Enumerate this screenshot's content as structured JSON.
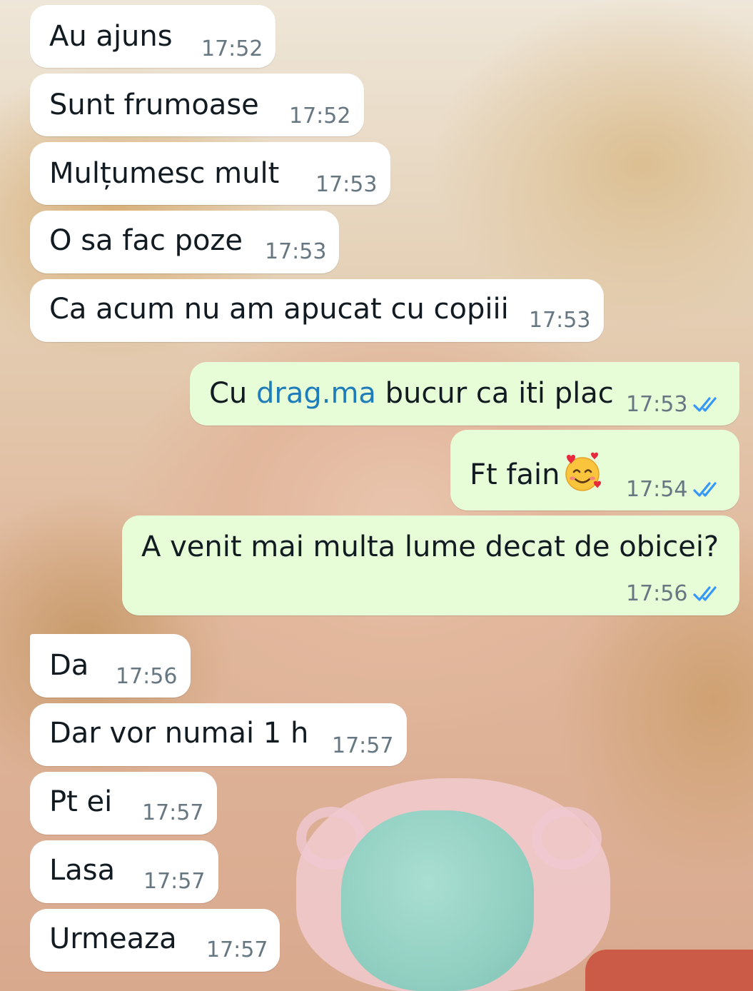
{
  "messages": [
    {
      "dir": "in",
      "text": "Au ajuns",
      "time": "17:52"
    },
    {
      "dir": "in",
      "text": "Sunt frumoase",
      "time": "17:52"
    },
    {
      "dir": "in",
      "text": "Mulțumesc mult",
      "time": "17:53"
    },
    {
      "dir": "in",
      "text": "O sa fac poze",
      "time": "17:53"
    },
    {
      "dir": "in",
      "text": "Ca acum nu am apucat cu copiii",
      "time": "17:53"
    },
    {
      "dir": "out",
      "text_before": "Cu ",
      "link": "drag.ma",
      "text_after": " bucur ca iti plac",
      "time": "17:53",
      "status": "read"
    },
    {
      "dir": "out",
      "text": "Ft fain",
      "emoji": "smiling-face-with-hearts",
      "time": "17:54",
      "status": "read"
    },
    {
      "dir": "out",
      "text": "A venit mai multa lume decat de obicei?",
      "time": "17:56",
      "status": "read"
    },
    {
      "dir": "in",
      "text": "Da",
      "time": "17:56"
    },
    {
      "dir": "in",
      "text": "Dar vor numai 1 h",
      "time": "17:57"
    },
    {
      "dir": "in",
      "text": "Pt ei",
      "time": "17:57"
    },
    {
      "dir": "in",
      "text": "Lasa",
      "time": "17:57"
    },
    {
      "dir": "in",
      "text": "Urmeaza",
      "time": "17:57"
    }
  ],
  "colors": {
    "incoming_bubble": "#ffffff",
    "outgoing_bubble": "#e7fdd8",
    "link": "#1e7db9",
    "read_ticks": "#3497f9",
    "timestamp": "#667781"
  },
  "icons": {
    "read_receipt": "double-check-icon",
    "emoji": "smiling-face-with-hearts-emoji"
  }
}
